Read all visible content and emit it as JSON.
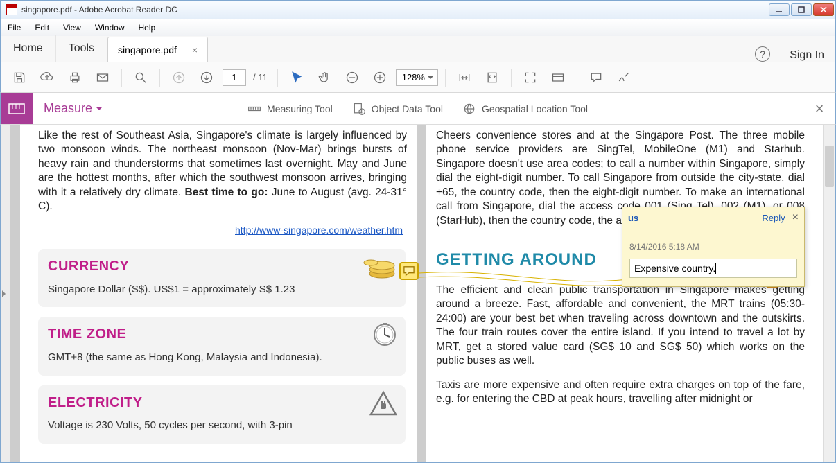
{
  "window": {
    "title": "singapore.pdf - Adobe Acrobat Reader DC"
  },
  "menu": {
    "file": "File",
    "edit": "Edit",
    "view": "View",
    "window": "Window",
    "help": "Help"
  },
  "apptabs": {
    "home": "Home",
    "tools": "Tools",
    "doc": "singapore.pdf",
    "signin": "Sign In"
  },
  "toolbar": {
    "page_current": "1",
    "page_total": "/ 11",
    "zoom": "128%"
  },
  "measure": {
    "title": "Measure",
    "measuring_tool": "Measuring Tool",
    "object_data_tool": "Object Data Tool",
    "geospatial_tool": "Geospatial Location Tool"
  },
  "doc": {
    "climate_para": "Like the rest of Southeast Asia, Singapore's climate is largely influenced by two monsoon winds. The northeast monsoon (Nov-Mar) brings bursts of heavy rain and thunderstorms that sometimes last overnight. May and June are the hottest months, after which the southwest monsoon arrives, bringing with it a relatively dry climate. ",
    "best_time_label": "Best time to go:",
    "best_time_value": " June to August (avg. 24-31° C).",
    "weather_link": "http://www-singapore.com/weather.htm",
    "currency": {
      "title": "CURRENCY",
      "text": "Singapore Dollar (S$). US$1 = approximately S$ 1.23"
    },
    "timezone": {
      "title": "TIME ZONE",
      "text": "GMT+8 (the same as Hong Kong, Malaysia and Indonesia)."
    },
    "electricity": {
      "title": "ELECTRICITY",
      "text": "Voltage is 230 Volts, 50 cycles per second, with 3-pin"
    },
    "phone_para": "Cheers convenience stores and at the Singapore Post. The three mobile phone service providers are SingTel, MobileOne (M1) and Starhub. Singapore doesn't use area codes; to call a number within Singapore, simply dial the eight-digit number. To call Singapore from outside the city-state, dial +65, the country code, then the eight-digit number. To make an international call from Singapore, dial the access code 001 (Sing Tel), 002 (M1), or 008 (StarHub), then the country code, the area code and the number.",
    "getting_around_title": "GETTING AROUND",
    "getting_around_p1": "The efficient and clean public transportation in Singapore makes getting around a breeze. Fast, affordable and convenient, the MRT trains (05:30-24:00) are your best bet when traveling across downtown and the outskirts. The four train routes cover the entire island. If you intend to travel a lot by MRT, get a stored value card (SG$ 10 and SG$ 50) which works on the public buses as well.",
    "getting_around_p2": "Taxis are more expensive and often require extra charges on top of the fare, e.g. for entering the CBD at peak hours, travelling after midnight or"
  },
  "comment": {
    "author": "us",
    "reply": "Reply",
    "date": "8/14/2016  5:18 AM",
    "text": "Expensive country."
  }
}
